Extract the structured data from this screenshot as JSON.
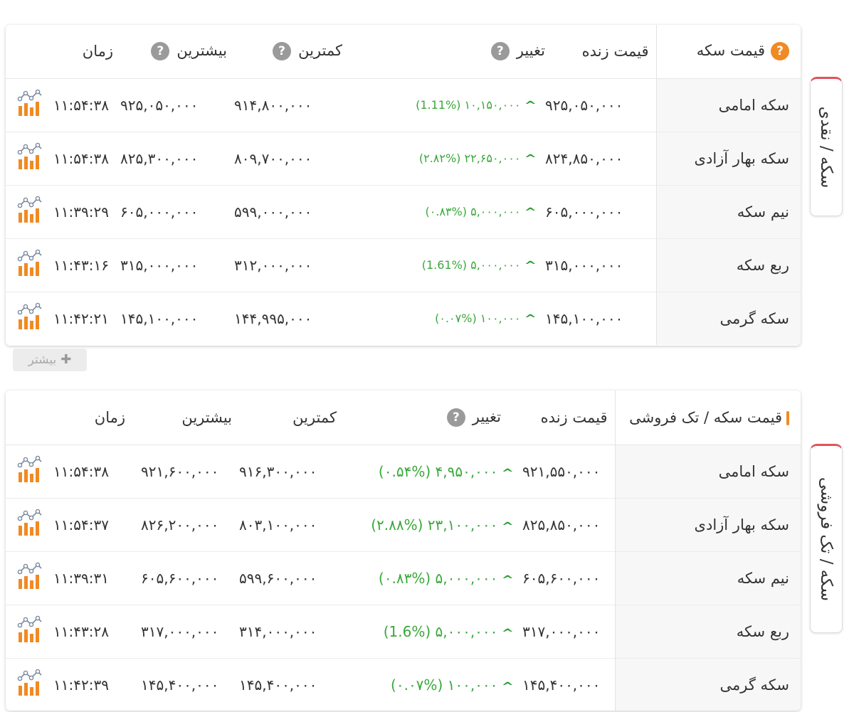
{
  "tables": [
    {
      "header": {
        "name": "قیمت سکه",
        "live_price": "قیمت زنده",
        "change": "تغییر",
        "low": "کمترین",
        "high": "بیشترین",
        "time": "زمان"
      },
      "rows": [
        {
          "name": "سکه امامی",
          "price": "۹۲۵,۰۵۰,۰۰۰",
          "change": "۱۰,۱۵۰,۰۰۰ (1.11%)",
          "low": "۹۱۴,۸۰۰,۰۰۰",
          "high": "۹۲۵,۰۵۰,۰۰۰",
          "time": "۱۱:۵۴:۳۸"
        },
        {
          "name": "سکه بهار آزادی",
          "price": "۸۲۴,۸۵۰,۰۰۰",
          "change": "۲۲,۶۵۰,۰۰۰ (۲.۸۲%)",
          "low": "۸۰۹,۷۰۰,۰۰۰",
          "high": "۸۲۵,۳۰۰,۰۰۰",
          "time": "۱۱:۵۴:۳۸"
        },
        {
          "name": "نیم سکه",
          "price": "۶۰۵,۰۰۰,۰۰۰",
          "change": "۵,۰۰۰,۰۰۰ (۰.۸۳%)",
          "low": "۵۹۹,۰۰۰,۰۰۰",
          "high": "۶۰۵,۰۰۰,۰۰۰",
          "time": "۱۱:۳۹:۲۹"
        },
        {
          "name": "ربع سکه",
          "price": "۳۱۵,۰۰۰,۰۰۰",
          "change": "۵,۰۰۰,۰۰۰ (1.61%)",
          "low": "۳۱۲,۰۰۰,۰۰۰",
          "high": "۳۱۵,۰۰۰,۰۰۰",
          "time": "۱۱:۴۳:۱۶"
        },
        {
          "name": "سکه گرمی",
          "price": "۱۴۵,۱۰۰,۰۰۰",
          "change": "۱۰۰,۰۰۰ (۰.۰۷%)",
          "low": "۱۴۴,۹۹۵,۰۰۰",
          "high": "۱۴۵,۱۰۰,۰۰۰",
          "time": "۱۱:۴۲:۲۱"
        }
      ],
      "more_label": "بیشتر",
      "side_tab": "سکه / نقدی"
    },
    {
      "header": {
        "name": "قیمت سکه / تک فروشی",
        "live_price": "قیمت زنده",
        "change": "تغییر",
        "low": "کمترین",
        "high": "بیشترین",
        "time": "زمان"
      },
      "rows": [
        {
          "name": "سکه امامی",
          "price": "۹۲۱,۵۵۰,۰۰۰",
          "change": "۴,۹۵۰,۰۰۰ (۰.۵۴%)",
          "low": "۹۱۶,۳۰۰,۰۰۰",
          "high": "۹۲۱,۶۰۰,۰۰۰",
          "time": "۱۱:۵۴:۳۸"
        },
        {
          "name": "سکه بهار آزادی",
          "price": "۸۲۵,۸۵۰,۰۰۰",
          "change": "۲۳,۱۰۰,۰۰۰ (۲.۸۸%)",
          "low": "۸۰۳,۱۰۰,۰۰۰",
          "high": "۸۲۶,۲۰۰,۰۰۰",
          "time": "۱۱:۵۴:۳۷"
        },
        {
          "name": "نیم سکه",
          "price": "۶۰۵,۶۰۰,۰۰۰",
          "change": "۵,۰۰۰,۰۰۰ (۰.۸۳%)",
          "low": "۵۹۹,۶۰۰,۰۰۰",
          "high": "۶۰۵,۶۰۰,۰۰۰",
          "time": "۱۱:۳۹:۳۱"
        },
        {
          "name": "ربع سکه",
          "price": "۳۱۷,۰۰۰,۰۰۰",
          "change": "۵,۰۰۰,۰۰۰ (1.6%)",
          "low": "۳۱۴,۰۰۰,۰۰۰",
          "high": "۳۱۷,۰۰۰,۰۰۰",
          "time": "۱۱:۴۳:۲۸"
        },
        {
          "name": "سکه گرمی",
          "price": "۱۴۵,۴۰۰,۰۰۰",
          "change": "۱۰۰,۰۰۰ (۰.۰۷%)",
          "low": "۱۴۵,۴۰۰,۰۰۰",
          "high": "۱۴۵,۴۰۰,۰۰۰",
          "time": "۱۱:۴۲:۳۹"
        }
      ],
      "side_tab": "سکه / تک فروشی"
    }
  ],
  "colors": {
    "positive": "#39a83a",
    "accent_orange": "#f08a24",
    "tab_accent": "#e0535a",
    "help_gray": "#9a9a9a"
  },
  "icons": {
    "help": "question-circle-icon",
    "up": "chevron-up-icon",
    "chart": "price-chart-icon",
    "plus": "plus-icon"
  }
}
